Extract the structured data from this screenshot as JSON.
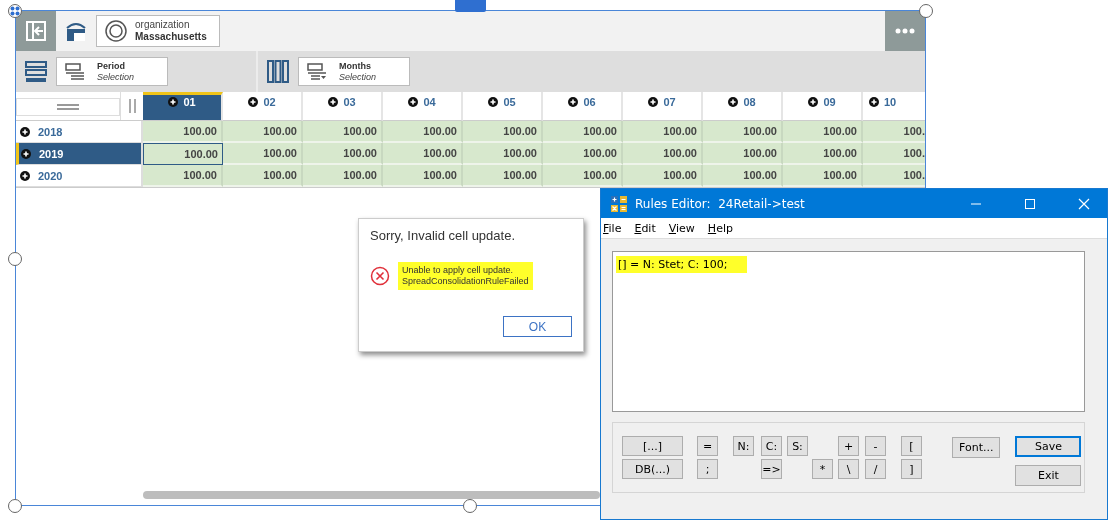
{
  "toolbar": {
    "organization": {
      "label": "organization",
      "value": "Massachusetts"
    }
  },
  "filters": [
    {
      "title": "Period",
      "subtitle": "Selection"
    },
    {
      "title": "Months",
      "subtitle": "Selection"
    }
  ],
  "grid": {
    "columns": [
      {
        "label": "01",
        "selected": true
      },
      {
        "label": "02",
        "selected": false
      },
      {
        "label": "03",
        "selected": false
      },
      {
        "label": "04",
        "selected": false
      },
      {
        "label": "05",
        "selected": false
      },
      {
        "label": "06",
        "selected": false
      },
      {
        "label": "07",
        "selected": false
      },
      {
        "label": "08",
        "selected": false
      },
      {
        "label": "09",
        "selected": false
      },
      {
        "label": "10",
        "selected": false
      }
    ],
    "rows": [
      {
        "label": "2018",
        "selected": false,
        "cells": [
          {
            "value": "100.00",
            "selected": false
          },
          {
            "value": "100.00",
            "selected": false
          },
          {
            "value": "100.00",
            "selected": false
          },
          {
            "value": "100.00",
            "selected": false
          },
          {
            "value": "100.00",
            "selected": false
          },
          {
            "value": "100.00",
            "selected": false
          },
          {
            "value": "100.00",
            "selected": false
          },
          {
            "value": "100.00",
            "selected": false
          },
          {
            "value": "100.00",
            "selected": false
          },
          {
            "value": "100.",
            "selected": false
          }
        ]
      },
      {
        "label": "2019",
        "selected": true,
        "cells": [
          {
            "value": "100.00",
            "selected": true
          },
          {
            "value": "100.00",
            "selected": false
          },
          {
            "value": "100.00",
            "selected": false
          },
          {
            "value": "100.00",
            "selected": false
          },
          {
            "value": "100.00",
            "selected": false
          },
          {
            "value": "100.00",
            "selected": false
          },
          {
            "value": "100.00",
            "selected": false
          },
          {
            "value": "100.00",
            "selected": false
          },
          {
            "value": "100.00",
            "selected": false
          },
          {
            "value": "100.",
            "selected": false
          }
        ]
      },
      {
        "label": "2020",
        "selected": false,
        "cells": [
          {
            "value": "100.00",
            "selected": false
          },
          {
            "value": "100.00",
            "selected": false
          },
          {
            "value": "100.00",
            "selected": false
          },
          {
            "value": "100.00",
            "selected": false
          },
          {
            "value": "100.00",
            "selected": false
          },
          {
            "value": "100.00",
            "selected": false
          },
          {
            "value": "100.00",
            "selected": false
          },
          {
            "value": "100.00",
            "selected": false
          },
          {
            "value": "100.00",
            "selected": false
          },
          {
            "value": "100.",
            "selected": false
          }
        ]
      }
    ]
  },
  "dialog": {
    "title": "Sorry, Invalid cell update.",
    "message_lines": [
      "Unable to apply cell update.",
      "SpreadConsolidationRuleFailed"
    ],
    "button": "OK"
  },
  "rules_editor": {
    "title": "Rules Editor:  24Retail->test",
    "menu": [
      "File",
      "Edit",
      "View",
      "Help"
    ],
    "rule_text": "[] = N: Stet; C: 100;",
    "token_rows": [
      [
        "[...]",
        "=",
        "N:",
        "C:",
        "S:",
        "+",
        "-",
        "["
      ],
      [
        "DB(...)",
        ";",
        "=>",
        "*",
        "\\",
        "/",
        "]"
      ]
    ],
    "font_button": "Font...",
    "save_button": "Save",
    "exit_button": "Exit"
  }
}
